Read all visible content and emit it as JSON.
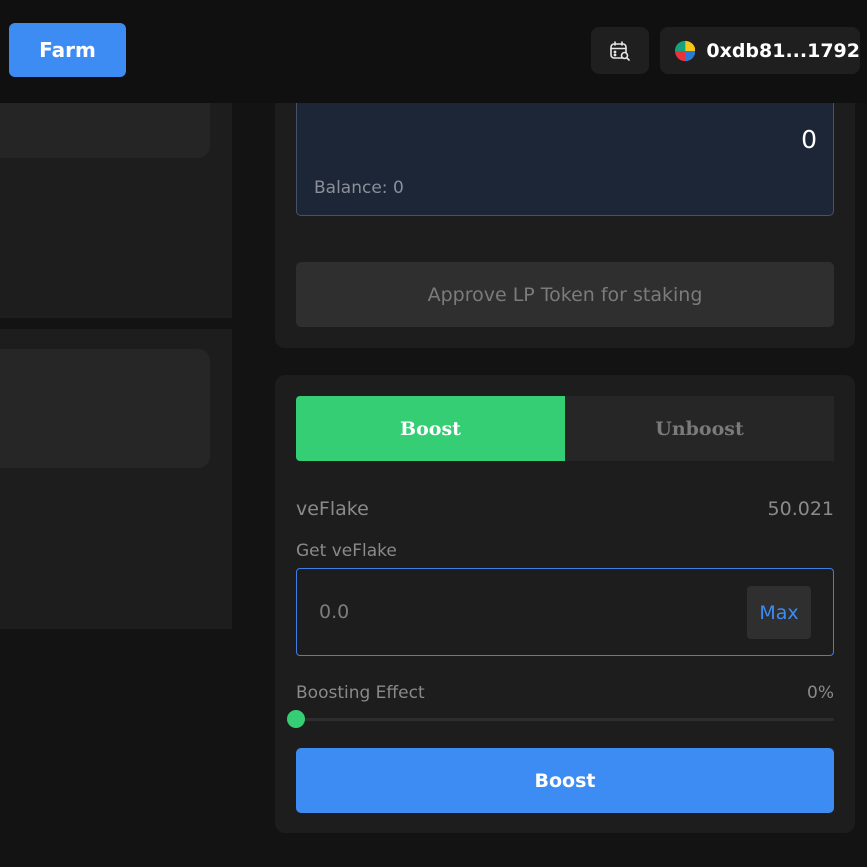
{
  "header": {
    "farm_label": "Farm",
    "calendar_icon": "calendar-search-icon",
    "wallet": {
      "address": "0xdb81...1792",
      "avatar_icon": "wallet-avatar-icon"
    }
  },
  "stake": {
    "amount": "0",
    "balance_label": "Balance:",
    "balance_value": "0",
    "approve_label": "Approve LP Token for staking"
  },
  "boost": {
    "tabs": [
      {
        "label": "Boost",
        "active": true
      },
      {
        "label": "Unboost",
        "active": false
      }
    ],
    "veflake_label": "veFlake",
    "veflake_value": "50.021",
    "get_label": "Get veFlake",
    "input_placeholder": "0.0",
    "input_value": "",
    "max_label": "Max",
    "effect_label": "Boosting Effect",
    "effect_value": "0%",
    "effect_fraction": 0,
    "submit_label": "Boost"
  },
  "colors": {
    "accent_blue": "#3d8cf4",
    "accent_green": "#36ce75",
    "background": "#131313",
    "card": "#1d1d1d"
  }
}
